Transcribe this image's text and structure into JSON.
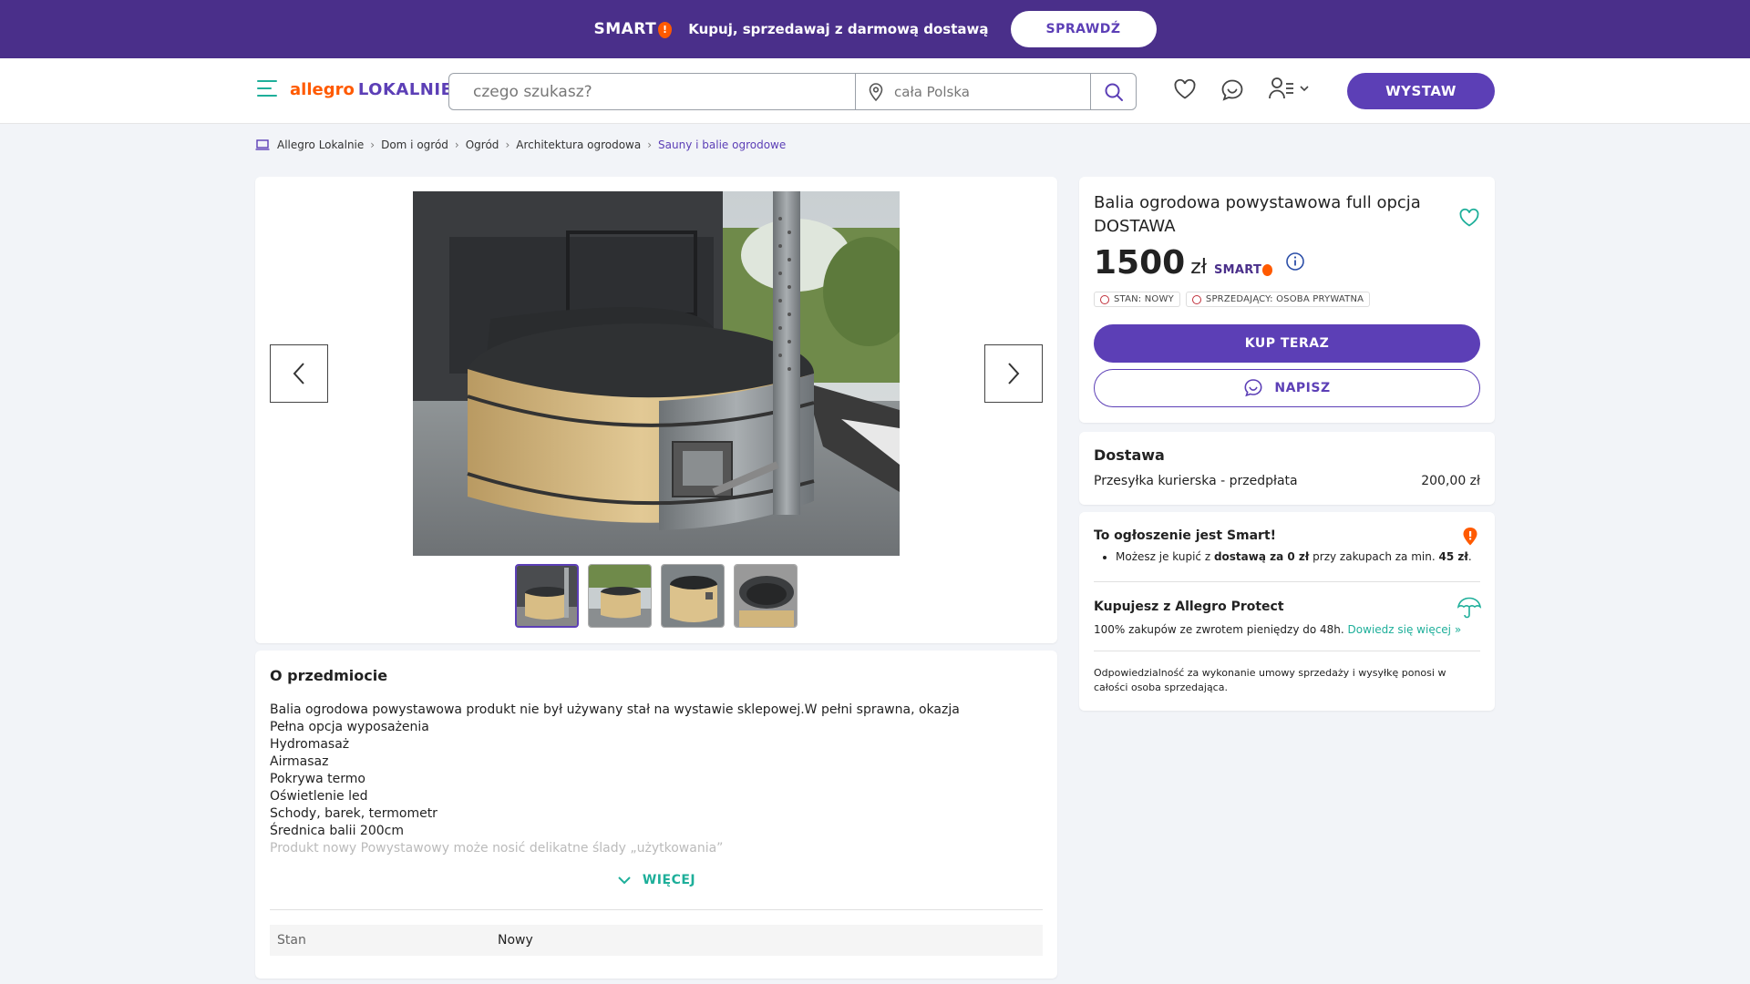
{
  "promo": {
    "brand": "SMART",
    "brand_badge": "!",
    "text": "Kupuj, sprzedawaj z darmową dostawą",
    "button": "SPRAWDŹ",
    "bg_color": "#4a2f8a"
  },
  "header": {
    "logo_part1": "allegro",
    "logo_part2": "LOKALNIE",
    "search_placeholder": "czego szukasz?",
    "location_placeholder": "cała Polska",
    "icons": [
      "menu-icon",
      "heart-icon",
      "chat-icon",
      "user-icon",
      "search-icon",
      "location-icon"
    ],
    "wystaw": "WYSTAW"
  },
  "breadcrumb": [
    "Allegro Lokalnie",
    "Dom i ogród",
    "Ogród",
    "Architektura ogrodowa",
    "Sauny i balie ogrodowe"
  ],
  "gallery": {
    "thumb_count": 4,
    "active_thumb": 1
  },
  "about": {
    "heading": "O przedmiocie",
    "lines": [
      "Balia ogrodowa powystawowa produkt nie był używany stał na wystawie sklepowej.W pełni sprawna, okazja",
      "Pełna opcja wyposażenia",
      "Hydromasaż",
      "Airmasaz",
      "Pokrywa termo",
      "Oświetlenie led",
      "Schody, barek, termometr",
      "Średnica balii 200cm",
      "Produkt nowy Powystawowy może nosić delikatne ślady „użytkowania”"
    ],
    "more": "WIĘCEJ",
    "param_key": "Stan",
    "param_value": "Nowy"
  },
  "offer": {
    "title": "Balia ogrodowa powystawowa full opcja DOSTAWA",
    "price": "1500",
    "currency": "zł",
    "smart_label": "SMART",
    "badge_condition": "STAN: NOWY",
    "badge_seller": "SPRZEDAJĄCY: OSOBA PRYWATNA",
    "buy_button": "KUP TERAZ",
    "message_button": "NAPISZ",
    "accent_color": "#5c3fb6"
  },
  "delivery": {
    "heading": "Dostawa",
    "method": "Przesyłka kurierska - przedpłata",
    "price": "200,00 zł"
  },
  "info": {
    "smart_title": "To ogłoszenie jest Smart!",
    "smart_text_1": "Możesz je kupić z ",
    "smart_text_bold": "dostawą za 0 zł",
    "smart_text_2": " przy zakupach za min. ",
    "smart_text_min": "45 zł",
    "smart_text_3": ".",
    "protect_title": "Kupujesz z Allegro Protect",
    "protect_text": "100% zakupów ze zwrotem pieniędzy do 48h.",
    "protect_link": "Dowiedz się więcej »",
    "liability": "Odpowiedzialność za wykonanie umowy sprzedaży i wysyłkę ponosi w całości osoba sprzedająca."
  }
}
